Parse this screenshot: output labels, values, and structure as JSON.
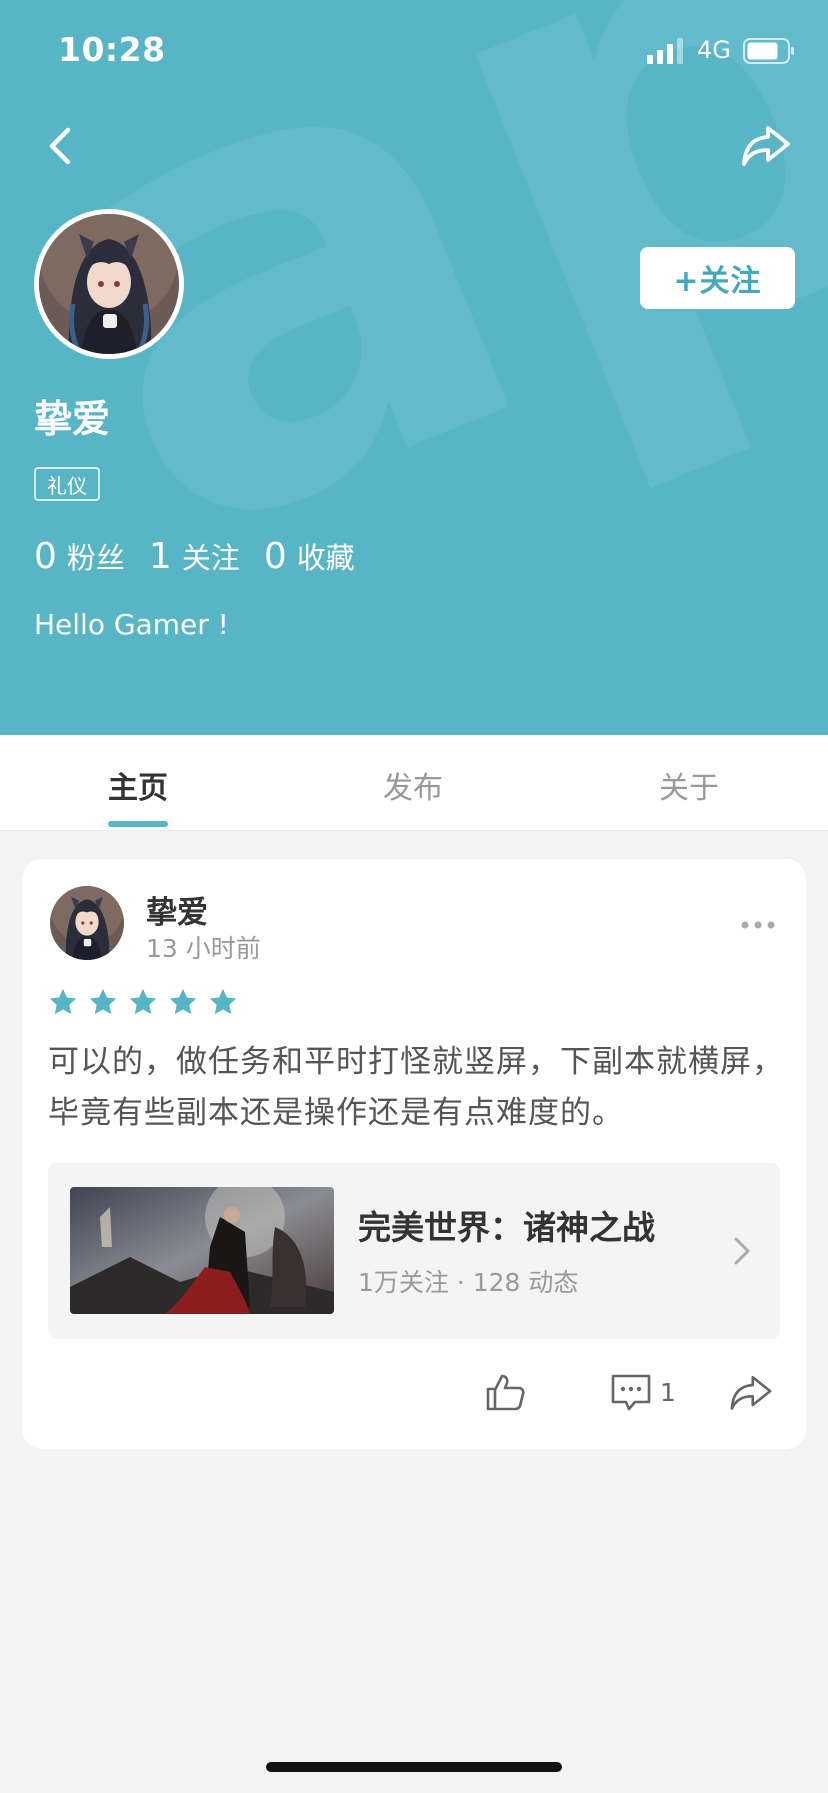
{
  "status_bar": {
    "time": "10:28",
    "network": "4G"
  },
  "profile": {
    "follow_label": "+关注",
    "username": "挚爱",
    "badge": "礼仪",
    "stats": [
      {
        "value": "0",
        "label": "粉丝"
      },
      {
        "value": "1",
        "label": "关注"
      },
      {
        "value": "0",
        "label": "收藏"
      }
    ],
    "bio": "Hello Gamer !"
  },
  "tabs": [
    {
      "label": "主页",
      "active": true
    },
    {
      "label": "发布",
      "active": false
    },
    {
      "label": "关于",
      "active": false
    }
  ],
  "post": {
    "author": "挚爱",
    "time": "13 小时前",
    "rating": 5,
    "text": "可以的，做任务和平时打怪就竖屏，下副本就横屏，毕竟有些副本还是操作还是有点难度的。",
    "game": {
      "title": "完美世界：诸神之战",
      "meta": "1万关注 · 128 动态"
    },
    "comment_count": "1"
  },
  "colors": {
    "accent": "#57b5c6",
    "follow_text": "#44a9bd",
    "star": "#57b5c6"
  }
}
